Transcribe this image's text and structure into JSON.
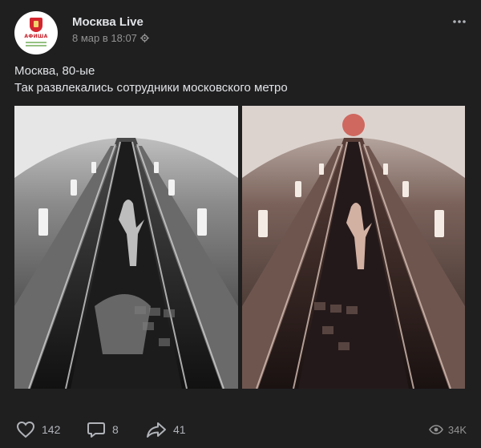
{
  "post": {
    "author": "Москва Live",
    "date": "8 мар в 18:07",
    "avatar_lines": [
      "АФИША",
      "Москва",
      "Москва Live"
    ],
    "text_line1": "Москва, 80-ые",
    "text_line2": "Так развлекались сотрудники московского метро"
  },
  "footer": {
    "likes": "142",
    "comments": "8",
    "shares": "41",
    "views": "34K"
  },
  "icons": {
    "more": "more-horizontal-icon",
    "settings": "gear-icon",
    "like": "heart-icon",
    "comment": "comment-icon",
    "share": "share-arrow-icon",
    "views": "eye-icon"
  },
  "colors": {
    "background": "#1f1f20",
    "text": "#e1e3e6",
    "muted": "#939393",
    "action": "#b0b3b8"
  }
}
